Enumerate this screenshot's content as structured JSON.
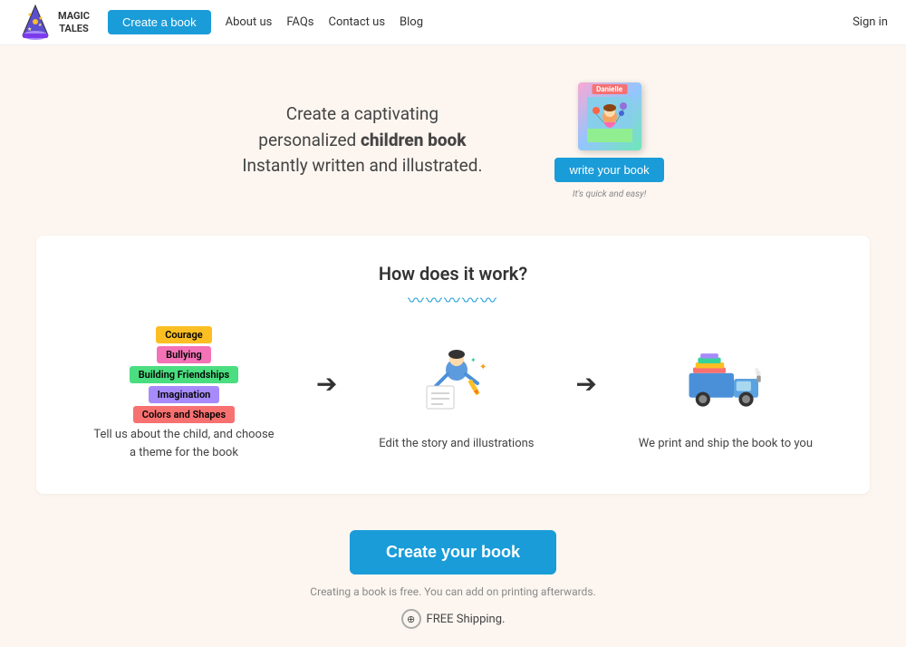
{
  "nav": {
    "logo_line1": "MAGIC",
    "logo_line2": "TALES",
    "create_book_btn": "Create a book",
    "links": [
      "About us",
      "FAQs",
      "Contact us",
      "Blog"
    ],
    "sign_in": "Sign in"
  },
  "hero": {
    "line1": "Create a captivating",
    "line2_prefix": "personalized ",
    "line2_bold": "children book",
    "line3": "Instantly written and illustrated.",
    "book_name": "Danielle",
    "write_book_btn": "write your book",
    "quick_easy": "It's quick and easy!"
  },
  "how": {
    "title": "How does it work?",
    "squiggle": "〰〰〰〰〰",
    "steps": [
      {
        "id": "step1",
        "tags": [
          {
            "label": "Courage",
            "color": "yellow"
          },
          {
            "label": "Bullying",
            "color": "pink"
          },
          {
            "label": "Building Friendships",
            "color": "green"
          },
          {
            "label": "Imagination",
            "color": "purple"
          },
          {
            "label": "Colors and Shapes",
            "color": "red"
          }
        ],
        "text": "Tell us about the child, and choose a theme for the book"
      },
      {
        "id": "step2",
        "text": "Edit the story and illustrations"
      },
      {
        "id": "step3",
        "text": "We print and ship the book to you"
      }
    ]
  },
  "cta": {
    "button_label": "Create your book",
    "subtext": "Creating a book is free. You can add on printing afterwards.",
    "shipping_label": "FREE Shipping."
  }
}
